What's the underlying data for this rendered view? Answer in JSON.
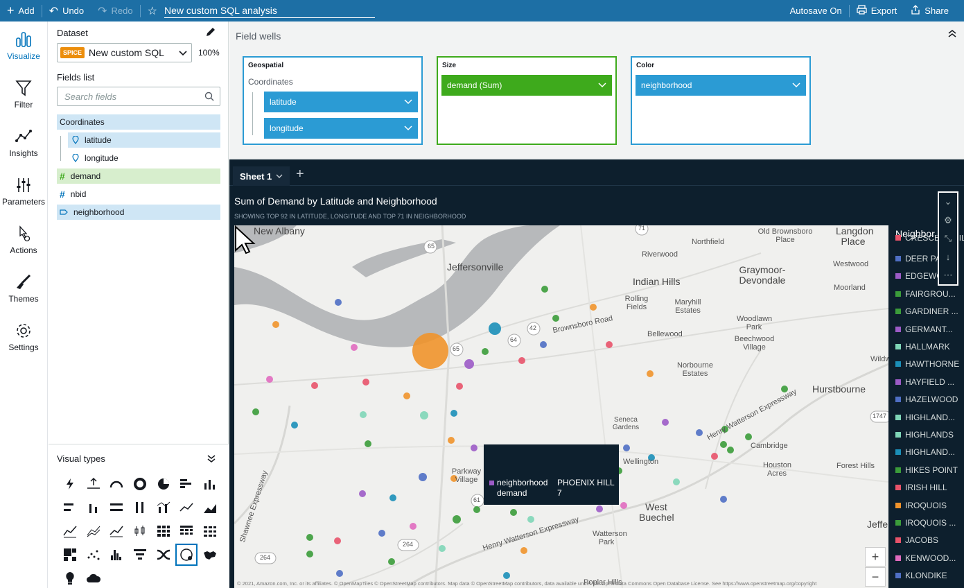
{
  "topbar": {
    "add": "Add",
    "undo": "Undo",
    "redo": "Redo",
    "analysis_name": "New custom SQL analysis",
    "autosave": "Autosave On",
    "export": "Export",
    "share": "Share"
  },
  "rail": [
    {
      "label": "Visualize",
      "icon": "bar-chart-icon",
      "active": true
    },
    {
      "label": "Filter",
      "icon": "funnel-icon"
    },
    {
      "label": "Insights",
      "icon": "insights-icon"
    },
    {
      "label": "Parameters",
      "icon": "sliders-icon"
    },
    {
      "label": "Actions",
      "icon": "pointer-gear-icon"
    },
    {
      "label": "Themes",
      "icon": "brush-icon"
    },
    {
      "label": "Settings",
      "icon": "gear-icon"
    }
  ],
  "datapane": {
    "dataset_title": "Dataset",
    "spice_badge": "SPICE",
    "dataset_name": "New custom SQL",
    "spice_percent": "100%",
    "fields_list_title": "Fields list",
    "search_placeholder": "Search fields",
    "fields": {
      "coordinates": "Coordinates",
      "latitude": "latitude",
      "longitude": "longitude",
      "demand": "demand",
      "nbid": "nbid",
      "neighborhood": "neighborhood"
    },
    "visual_types_title": "Visual types"
  },
  "wells": {
    "title": "Field wells",
    "geospatial": {
      "label": "Geospatial",
      "sub": "Coordinates",
      "pill1": "latitude",
      "pill2": "longitude"
    },
    "size": {
      "label": "Size",
      "pill": "demand (Sum)"
    },
    "color": {
      "label": "Color",
      "pill": "neighborhood"
    }
  },
  "sheet": {
    "tab": "Sheet 1",
    "visual_title": "Sum of Demand by Latitude and Neighborhood",
    "visual_subtitle": "SHOWING TOP 92 IN LATITUDE, LONGITUDE AND TOP 71 IN NEIGHBORHOOD"
  },
  "map": {
    "labels": {
      "new_albany": "New Albany",
      "jeffersonville": "Jeffersonville",
      "northfield": "Northfield",
      "riverwood": "Riverwood",
      "old_brownsboro": "Old Brownsboro Place",
      "langdon": "Langdon Place",
      "graymoor": "Graymoor-Devondale",
      "westwood": "Westwood",
      "indian_hills": "Indian Hills",
      "moorland": "Moorland",
      "rolling_fields": "Rolling Fields",
      "maryhill": "Maryhill Estates",
      "woodlawn": "Woodlawn Park",
      "brownsboro_road": "Brownsboro Road",
      "bellewood": "Bellewood",
      "beechwood": "Beechwood Village",
      "wildwood": "Wildwo",
      "norbourne": "Norbourne Estates",
      "hurstbourne": "Hurstbourne",
      "henry_watterson_1": "Henry Watterson Expressway",
      "cambridge": "Cambridge",
      "houston_acres": "Houston Acres",
      "forest_hills": "Forest Hills",
      "parkway_village": "Parkway Village",
      "wellington": "Wellington",
      "west_buechel": "West Buechel",
      "watterson_park": "Watterson Park",
      "henry_watterson_2": "Henry Watterson Expressway",
      "shawnee": "Shawnee Expressway",
      "seneca": "Seneca Gardens",
      "jeffe": "Jeffe",
      "poplar": "Poplar Hills",
      "r65a": "65",
      "r65b": "65",
      "r64": "64",
      "r42": "42",
      "r61": "61",
      "r264a": "264",
      "r264b": "264",
      "r71": "71",
      "r1747": "1747"
    },
    "attribution": "© 2021, Amazon.com, Inc. or its affiliates. © OpenMapTiles © OpenStreetMap contributors. Map data © OpenStreetMap contributors, data available under the Open Data Commons Open Database License. See https://www.openstreetmap.org/copyright",
    "zoom_in": "+",
    "zoom_out": "−"
  },
  "tooltip": {
    "k1": "neighborhood",
    "v1": "PHOENIX HILL",
    "k2": "demand",
    "v2": "7"
  },
  "legend": {
    "title": "Neighbor",
    "items": [
      {
        "label": "CRESCENT HILL",
        "color": "#e8536a"
      },
      {
        "label": "DEER PA",
        "color": "#4f6fc4"
      },
      {
        "label": "EDGEWO",
        "color": "#9c5bc6"
      },
      {
        "label": "FAIRGROU...",
        "color": "#3b9c3a"
      },
      {
        "label": "GARDINER ...",
        "color": "#3b9c3a"
      },
      {
        "label": "GERMANT...",
        "color": "#9c5bc6"
      },
      {
        "label": "HALLMARK",
        "color": "#7fd6b7"
      },
      {
        "label": "HAWTHORNE",
        "color": "#1b8fb8"
      },
      {
        "label": "HAYFIELD ...",
        "color": "#9c5bc6"
      },
      {
        "label": "HAZELWOOD",
        "color": "#4f6fc4"
      },
      {
        "label": "HIGHLAND...",
        "color": "#7fd6b7"
      },
      {
        "label": "HIGHLANDS",
        "color": "#7fd6b7"
      },
      {
        "label": "HIGHLAND...",
        "color": "#1b8fb8"
      },
      {
        "label": "HIKES POINT",
        "color": "#3b9c3a"
      },
      {
        "label": "IRISH HILL",
        "color": "#e8536a"
      },
      {
        "label": "IROQUOIS",
        "color": "#f0932b"
      },
      {
        "label": "IROQUOIS ...",
        "color": "#3b9c3a"
      },
      {
        "label": "JACOBS",
        "color": "#e8536a"
      },
      {
        "label": "KENWOOD...",
        "color": "#e06bbf"
      },
      {
        "label": "KLONDIKE",
        "color": "#4f6fc4"
      }
    ]
  }
}
